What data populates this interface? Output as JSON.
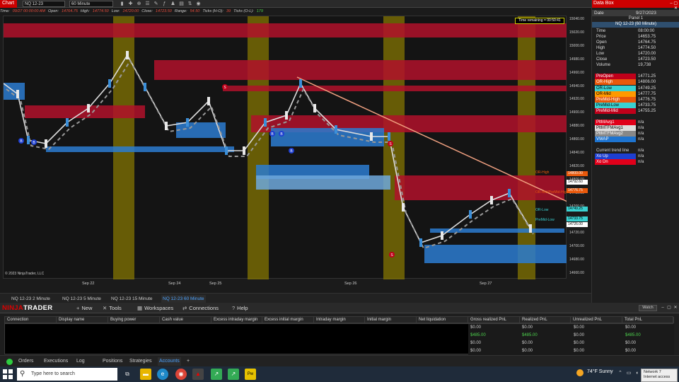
{
  "chart": {
    "tab_label": "Chart",
    "instrument": "NQ 12-23",
    "interval": "60 Minute",
    "infobar": [
      {
        "k": "Time:",
        "v": "09/27 00:00:00 AM",
        "g": false
      },
      {
        "k": "Open:",
        "v": "14764.75",
        "g": false
      },
      {
        "k": "High:",
        "v": "14774.50",
        "g": false
      },
      {
        "k": "Low:",
        "v": "14720.00",
        "g": false
      },
      {
        "k": "Close:",
        "v": "14723.50",
        "g": false
      },
      {
        "k": "Range:",
        "v": "54.50",
        "g": false
      },
      {
        "k": "Ticks (H-O):",
        "v": "39",
        "g": false
      },
      {
        "k": "Ticks (O-L):",
        "v": "179",
        "g": true
      }
    ],
    "time_remaining": "Time remaining = 00:50:41",
    "copyright": "© 2023 NinjaTrader, LLC",
    "x_labels": [
      "Sep 22",
      "Sep 24",
      "Sep 25",
      "Sep 26",
      "Sep 27"
    ],
    "y_ticks": [
      "15040.00",
      "15020.00",
      "15000.00",
      "14980.00",
      "14960.00",
      "14940.00",
      "14920.00",
      "14900.00",
      "14880.00",
      "14860.00",
      "14840.00",
      "14820.00",
      "14800.00",
      "14780.00",
      "14760.00",
      "14740.00",
      "14720.00",
      "14700.00",
      "14680.00",
      "14660.00"
    ],
    "y_labels": [
      {
        "text": "14800.00",
        "color": "#e8590c",
        "fg": "#fff"
      },
      {
        "text": "14792.60",
        "color": "#ffffff",
        "fg": "#000"
      },
      {
        "text": "14776.75",
        "color": "#e8590c",
        "fg": "#fff"
      },
      {
        "text": "14749.25",
        "color": "#3ad1d1",
        "fg": "#000"
      },
      {
        "text": "14733.75",
        "color": "#3ad1d1",
        "fg": "#000"
      },
      {
        "text": "14726.00",
        "color": "#ffffff",
        "fg": "#000"
      }
    ],
    "plot_labels": [
      "OR-High",
      "OR-Mid/PreMid-High",
      "OR-Low",
      "PreMid-Low"
    ],
    "markers": [
      "B",
      "B",
      "B",
      "B",
      "B",
      "S",
      "S",
      "S"
    ],
    "tabs": [
      "NQ 12-23 2 Minute",
      "NQ 12-23 5 Minute",
      "NQ 12-23 15 Minute",
      "NQ 12-23 60 Minute"
    ],
    "active_tab": "NQ 12-23 60 Minute"
  },
  "databox": {
    "title": "Data Box",
    "date_label": "Date",
    "date_value": "9/27/2023",
    "panel": "Panel 1",
    "series": "NQ 12-23 (60 Minute)",
    "rows": [
      {
        "k": "Time",
        "v": "08:00:00",
        "bg": ""
      },
      {
        "k": "Price",
        "v": "14653.75",
        "bg": ""
      },
      {
        "k": "Open",
        "v": "14764.75",
        "bg": ""
      },
      {
        "k": "High",
        "v": "14774.50",
        "bg": ""
      },
      {
        "k": "Low",
        "v": "14720.00",
        "bg": ""
      },
      {
        "k": "Close",
        "v": "14723.50",
        "bg": ""
      },
      {
        "k": "Volume",
        "v": "19,738",
        "bg": ""
      },
      {
        "k": "",
        "v": "",
        "bg": ""
      },
      {
        "k": "PreOpen",
        "v": "14771.25",
        "bg": "#c0001a"
      },
      {
        "k": "OR-High",
        "v": "14806.00",
        "bg": "#e8590c"
      },
      {
        "k": "OR-Low",
        "v": "14749.25",
        "bg": "#3ad1d1"
      },
      {
        "k": "OR-Mid",
        "v": "14777.75",
        "bg": "#ff9900"
      },
      {
        "k": "PreMid-High",
        "v": "14776.75",
        "bg": "#e8590c"
      },
      {
        "k": "PreMid-Low",
        "v": "14733.75",
        "bg": "#3ad1d1"
      },
      {
        "k": "PreMid-Mid",
        "v": "14755.25",
        "bg": "#c0001a"
      },
      {
        "k": "",
        "v": "",
        "bg": ""
      },
      {
        "k": "PltMAvg1",
        "v": "n/a",
        "bg": "#e0001a"
      },
      {
        "k": "PltMTFMAvg1",
        "v": "n/a",
        "bg": "#dddddd"
      },
      {
        "k": "PltMTFMAvg2",
        "v": "n/a",
        "bg": "#888888"
      },
      {
        "k": "VWAP",
        "v": "n/a",
        "bg": "#1e74d0"
      },
      {
        "k": "",
        "v": "",
        "bg": ""
      },
      {
        "k": "Current trend line",
        "v": "n/a",
        "bg": ""
      },
      {
        "k": "Xo Up",
        "v": "n/a",
        "bg": "#1e3fd0"
      },
      {
        "k": "Xo Dn",
        "v": "n/a",
        "bg": "#e0001a"
      }
    ]
  },
  "control_center": {
    "logo_a": "NINJA",
    "logo_b": "TRADER",
    "menu": [
      {
        "icon": "+",
        "label": "New"
      },
      {
        "icon": "✕",
        "label": "Tools"
      },
      {
        "icon": "▦",
        "label": "Workspaces"
      },
      {
        "icon": "⇄",
        "label": "Connections"
      },
      {
        "icon": "?",
        "label": "Help"
      }
    ],
    "watch": "Watch",
    "columns": [
      "Connection",
      "Display name",
      "Buying power",
      "Cash value",
      "Excess intraday margin",
      "Excess initial margin",
      "Intraday margin",
      "Initial margin",
      "Net liquidation",
      "Gross realized PnL",
      "Realized PnL",
      "Unrealized PnL",
      "Total PnL"
    ],
    "rows": [
      {
        "gross": "$0.00",
        "realized": "$0.00",
        "unrealized": "$0.00",
        "total": "$0.00",
        "g": false
      },
      {
        "gross": "$485.00",
        "realized": "$485.00",
        "unrealized": "$0.00",
        "total": "$485.00",
        "g": true
      },
      {
        "gross": "$0.00",
        "realized": "$0.00",
        "unrealized": "$0.00",
        "total": "$0.00",
        "g": false
      },
      {
        "gross": "$0.00",
        "realized": "$0.00",
        "unrealized": "$0.00",
        "total": "$0.00",
        "g": false
      }
    ],
    "tabs": [
      "Orders",
      "Executions",
      "Log",
      "Positions",
      "Strategies",
      "Accounts"
    ],
    "active_tab": "Accounts",
    "add_tab": "+"
  },
  "taskbar": {
    "search_placeholder": "Type here to search",
    "weather": "74°F  Sunny",
    "network_tip_1": "Network 7",
    "network_tip_2": "Internet access"
  }
}
